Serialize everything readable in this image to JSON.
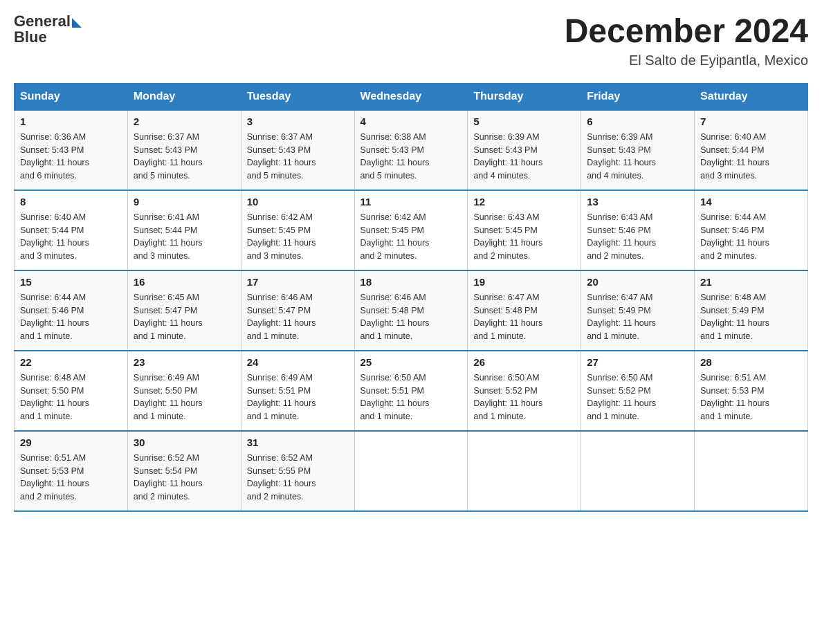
{
  "logo": {
    "text_general": "General",
    "text_blue": "Blue"
  },
  "title": "December 2024",
  "location": "El Salto de Eyipantla, Mexico",
  "days_of_week": [
    "Sunday",
    "Monday",
    "Tuesday",
    "Wednesday",
    "Thursday",
    "Friday",
    "Saturday"
  ],
  "weeks": [
    [
      {
        "day": "1",
        "sunrise": "6:36 AM",
        "sunset": "5:43 PM",
        "daylight": "11 hours and 6 minutes."
      },
      {
        "day": "2",
        "sunrise": "6:37 AM",
        "sunset": "5:43 PM",
        "daylight": "11 hours and 5 minutes."
      },
      {
        "day": "3",
        "sunrise": "6:37 AM",
        "sunset": "5:43 PM",
        "daylight": "11 hours and 5 minutes."
      },
      {
        "day": "4",
        "sunrise": "6:38 AM",
        "sunset": "5:43 PM",
        "daylight": "11 hours and 5 minutes."
      },
      {
        "day": "5",
        "sunrise": "6:39 AM",
        "sunset": "5:43 PM",
        "daylight": "11 hours and 4 minutes."
      },
      {
        "day": "6",
        "sunrise": "6:39 AM",
        "sunset": "5:43 PM",
        "daylight": "11 hours and 4 minutes."
      },
      {
        "day": "7",
        "sunrise": "6:40 AM",
        "sunset": "5:44 PM",
        "daylight": "11 hours and 3 minutes."
      }
    ],
    [
      {
        "day": "8",
        "sunrise": "6:40 AM",
        "sunset": "5:44 PM",
        "daylight": "11 hours and 3 minutes."
      },
      {
        "day": "9",
        "sunrise": "6:41 AM",
        "sunset": "5:44 PM",
        "daylight": "11 hours and 3 minutes."
      },
      {
        "day": "10",
        "sunrise": "6:42 AM",
        "sunset": "5:45 PM",
        "daylight": "11 hours and 3 minutes."
      },
      {
        "day": "11",
        "sunrise": "6:42 AM",
        "sunset": "5:45 PM",
        "daylight": "11 hours and 2 minutes."
      },
      {
        "day": "12",
        "sunrise": "6:43 AM",
        "sunset": "5:45 PM",
        "daylight": "11 hours and 2 minutes."
      },
      {
        "day": "13",
        "sunrise": "6:43 AM",
        "sunset": "5:46 PM",
        "daylight": "11 hours and 2 minutes."
      },
      {
        "day": "14",
        "sunrise": "6:44 AM",
        "sunset": "5:46 PM",
        "daylight": "11 hours and 2 minutes."
      }
    ],
    [
      {
        "day": "15",
        "sunrise": "6:44 AM",
        "sunset": "5:46 PM",
        "daylight": "11 hours and 1 minute."
      },
      {
        "day": "16",
        "sunrise": "6:45 AM",
        "sunset": "5:47 PM",
        "daylight": "11 hours and 1 minute."
      },
      {
        "day": "17",
        "sunrise": "6:46 AM",
        "sunset": "5:47 PM",
        "daylight": "11 hours and 1 minute."
      },
      {
        "day": "18",
        "sunrise": "6:46 AM",
        "sunset": "5:48 PM",
        "daylight": "11 hours and 1 minute."
      },
      {
        "day": "19",
        "sunrise": "6:47 AM",
        "sunset": "5:48 PM",
        "daylight": "11 hours and 1 minute."
      },
      {
        "day": "20",
        "sunrise": "6:47 AM",
        "sunset": "5:49 PM",
        "daylight": "11 hours and 1 minute."
      },
      {
        "day": "21",
        "sunrise": "6:48 AM",
        "sunset": "5:49 PM",
        "daylight": "11 hours and 1 minute."
      }
    ],
    [
      {
        "day": "22",
        "sunrise": "6:48 AM",
        "sunset": "5:50 PM",
        "daylight": "11 hours and 1 minute."
      },
      {
        "day": "23",
        "sunrise": "6:49 AM",
        "sunset": "5:50 PM",
        "daylight": "11 hours and 1 minute."
      },
      {
        "day": "24",
        "sunrise": "6:49 AM",
        "sunset": "5:51 PM",
        "daylight": "11 hours and 1 minute."
      },
      {
        "day": "25",
        "sunrise": "6:50 AM",
        "sunset": "5:51 PM",
        "daylight": "11 hours and 1 minute."
      },
      {
        "day": "26",
        "sunrise": "6:50 AM",
        "sunset": "5:52 PM",
        "daylight": "11 hours and 1 minute."
      },
      {
        "day": "27",
        "sunrise": "6:50 AM",
        "sunset": "5:52 PM",
        "daylight": "11 hours and 1 minute."
      },
      {
        "day": "28",
        "sunrise": "6:51 AM",
        "sunset": "5:53 PM",
        "daylight": "11 hours and 1 minute."
      }
    ],
    [
      {
        "day": "29",
        "sunrise": "6:51 AM",
        "sunset": "5:53 PM",
        "daylight": "11 hours and 2 minutes."
      },
      {
        "day": "30",
        "sunrise": "6:52 AM",
        "sunset": "5:54 PM",
        "daylight": "11 hours and 2 minutes."
      },
      {
        "day": "31",
        "sunrise": "6:52 AM",
        "sunset": "5:55 PM",
        "daylight": "11 hours and 2 minutes."
      },
      null,
      null,
      null,
      null
    ]
  ],
  "labels": {
    "sunrise": "Sunrise:",
    "sunset": "Sunset:",
    "daylight": "Daylight:"
  }
}
